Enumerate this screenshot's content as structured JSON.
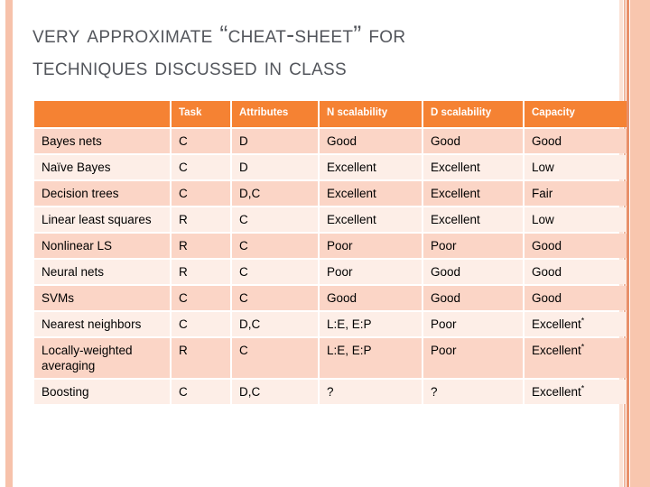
{
  "slide": {
    "title_line1": "Very approximate “cheat-sheet” for",
    "title_line2": "techniques Discussed in Class",
    "title_color": "#53565C",
    "background_color": "#FFFFFF"
  },
  "theme": {
    "header_fill": "#F58233",
    "header_text": "#FFFFFF",
    "row_odd_fill": "#FBD5C6",
    "row_even_fill": "#FDEEE7",
    "edge_bar_light": "#F7C2AB",
    "edge_bar_dark": "#E8906A",
    "body_text": "#000000"
  },
  "table": {
    "columns": [
      {
        "key": "name",
        "label": ""
      },
      {
        "key": "task",
        "label": "Task"
      },
      {
        "key": "attributes",
        "label": "Attributes"
      },
      {
        "key": "n_scalability",
        "label": "N scalability"
      },
      {
        "key": "d_scalability",
        "label": "D scalability"
      },
      {
        "key": "capacity",
        "label": "Capacity"
      }
    ],
    "rows": [
      {
        "name": "Bayes nets",
        "task": "C",
        "attributes": "D",
        "n_scalability": "Good",
        "d_scalability": "Good",
        "capacity": "Good"
      },
      {
        "name": "Naïve Bayes",
        "task": "C",
        "attributes": "D",
        "n_scalability": "Excellent",
        "d_scalability": "Excellent",
        "capacity": "Low"
      },
      {
        "name": "Decision trees",
        "task": "C",
        "attributes": "D,C",
        "n_scalability": "Excellent",
        "d_scalability": "Excellent",
        "capacity": "Fair"
      },
      {
        "name": "Linear least squares",
        "task": "R",
        "attributes": "C",
        "n_scalability": "Excellent",
        "d_scalability": "Excellent",
        "capacity": "Low"
      },
      {
        "name": "Nonlinear LS",
        "task": "R",
        "attributes": "C",
        "n_scalability": "Poor",
        "d_scalability": "Poor",
        "capacity": "Good"
      },
      {
        "name": "Neural nets",
        "task": "R",
        "attributes": "C",
        "n_scalability": "Poor",
        "d_scalability": "Good",
        "capacity": "Good"
      },
      {
        "name": "SVMs",
        "task": "C",
        "attributes": "C",
        "n_scalability": "Good",
        "d_scalability": "Good",
        "capacity": "Good"
      },
      {
        "name": "Nearest neighbors",
        "task": "C",
        "attributes": "D,C",
        "n_scalability": "L:E, E:P",
        "d_scalability": "Poor",
        "capacity": "Excellent",
        "capacity_asterisk": "*"
      },
      {
        "name": "Locally-weighted averaging",
        "task": "R",
        "attributes": "C",
        "n_scalability": "L:E, E:P",
        "d_scalability": "Poor",
        "capacity": "Excellent",
        "capacity_asterisk": "*"
      },
      {
        "name": "Boosting",
        "task": "C",
        "attributes": "D,C",
        "n_scalability": "?",
        "d_scalability": "?",
        "capacity": "Excellent",
        "capacity_asterisk": "*"
      }
    ]
  }
}
